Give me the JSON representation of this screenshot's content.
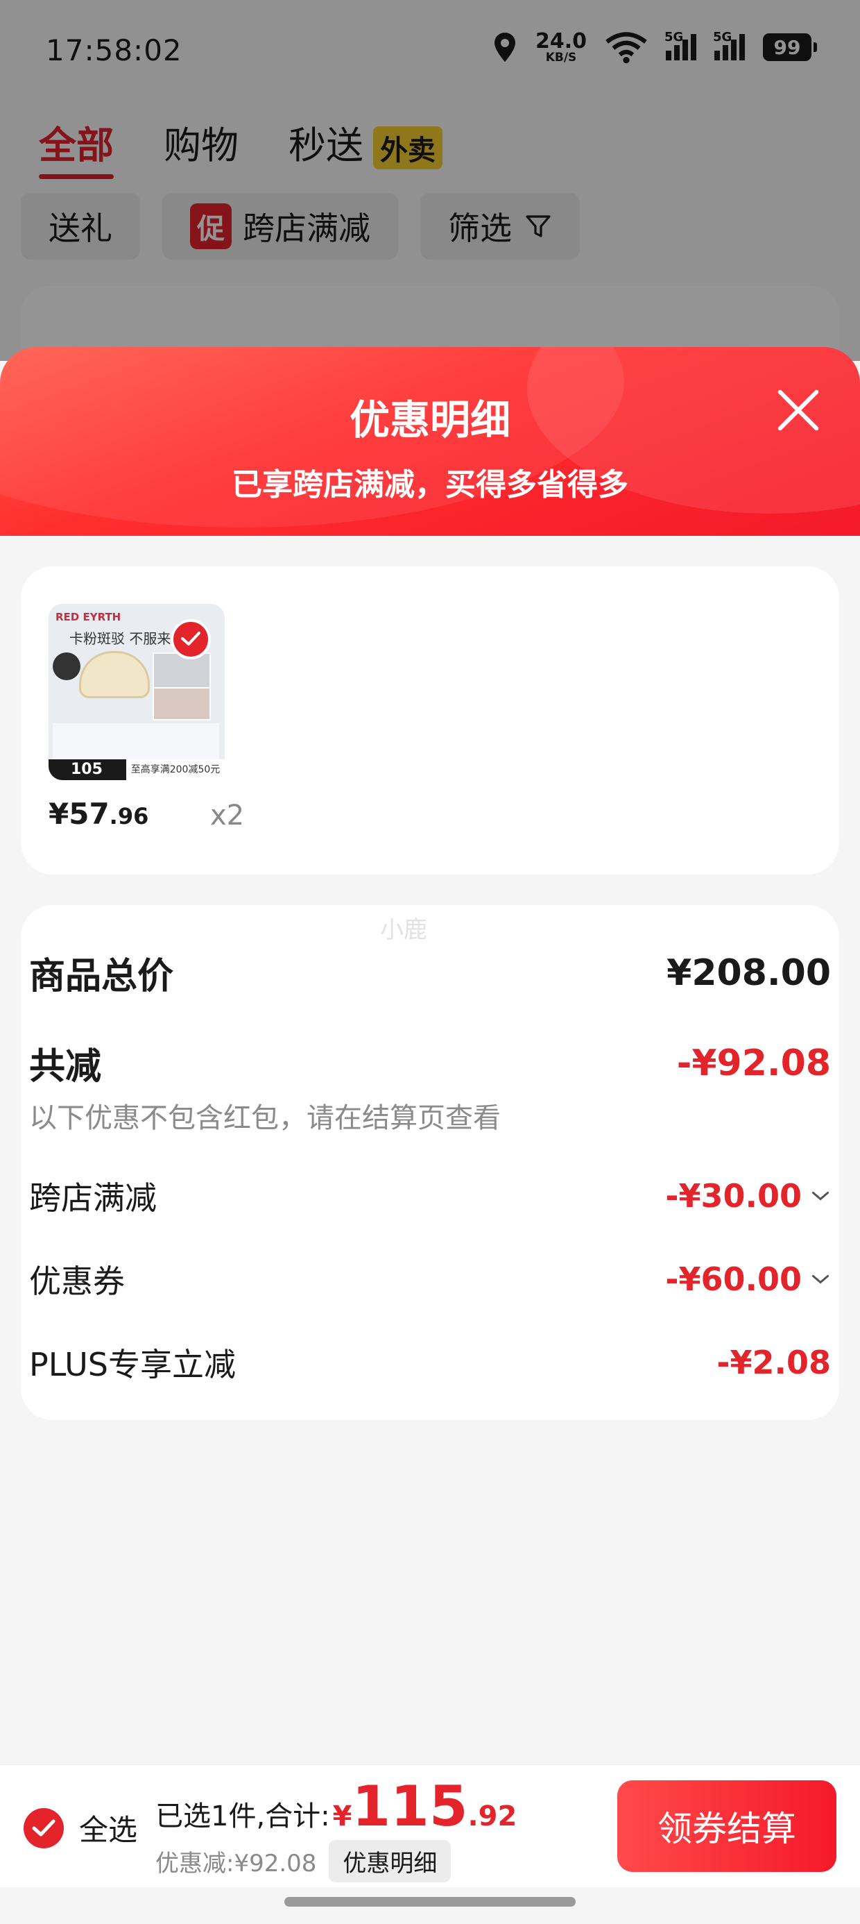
{
  "status_bar": {
    "time": "17:58:02",
    "net_speed_value": "24.0",
    "net_speed_unit": "KB/S",
    "signal_1_label": "5G",
    "signal_2_label": "5G",
    "battery": "99"
  },
  "top_tabs": [
    {
      "label": "全部",
      "active": true
    },
    {
      "label": "购物",
      "active": false
    },
    {
      "label": "秒送",
      "active": false,
      "badge": "外卖"
    }
  ],
  "filters": {
    "gift": "送礼",
    "promo_tag": "促",
    "cross_store": "跨店满减",
    "filter": "筛选"
  },
  "sheet": {
    "title": "优惠明细",
    "subtitle": "已享跨店满减，买得多省得多"
  },
  "product": {
    "brand_text": "RED EYRTH",
    "slogan_text": "卡粉斑驳 不服来",
    "thumb_price": "105",
    "thumb_promo": "至高享满200减50元",
    "price_int": "¥57",
    "price_dec": ".96",
    "qty": "x2"
  },
  "watermark": "小鹿",
  "summary": {
    "total_label": "商品总价",
    "total_value": "¥208.00",
    "reduce_label": "共减",
    "reduce_value": "-¥92.08",
    "note": "以下优惠不包含红包，请在结算页查看",
    "items": [
      {
        "label": "跨店满减",
        "value": "-¥30.00",
        "expandable": true
      },
      {
        "label": "优惠券",
        "value": "-¥60.00",
        "expandable": true
      },
      {
        "label": "PLUS专享立减",
        "value": "-¥2.08",
        "expandable": false
      }
    ]
  },
  "bottom_bar": {
    "select_all": "全选",
    "selected_text": "已选1件,合计:",
    "currency": "¥",
    "total_int": "115",
    "total_dec": ".92",
    "discount_text": "优惠减:¥92.08",
    "detail_button": "优惠明细",
    "checkout_button": "领券结算"
  },
  "colors": {
    "accent_red": "#e4242b",
    "tab_badge_yellow": "#f7cf2f"
  }
}
